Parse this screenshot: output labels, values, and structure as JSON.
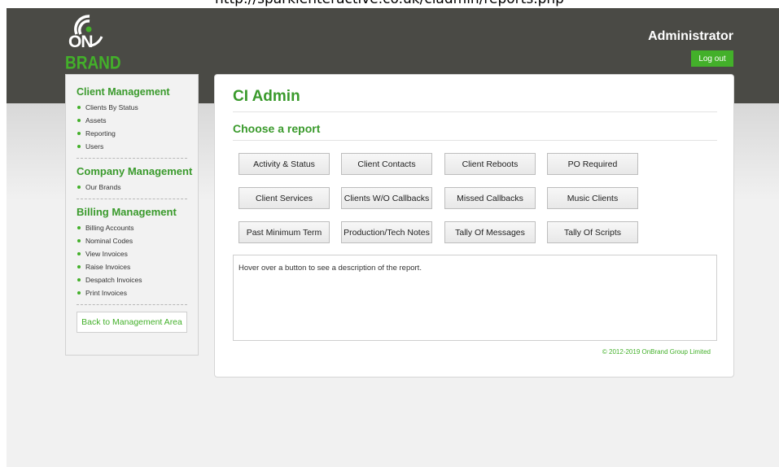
{
  "browser": {
    "url": "http://sparklenteractive.co.uk/ciadmin/reports.php"
  },
  "header": {
    "logo_top": "ON",
    "logo_bottom": "BRAND",
    "user_title": "Administrator",
    "logout_label": "Log out"
  },
  "sidebar": {
    "client_heading": "Client Management",
    "client_items": [
      "Clients By Status",
      "Assets",
      "Reporting",
      "Users"
    ],
    "company_heading": "Company Management",
    "company_items": [
      "Our Brands"
    ],
    "billing_heading": "Billing Management",
    "billing_items": [
      "Billing Accounts",
      "Nominal Codes",
      "View Invoices",
      "Raise Invoices",
      "Despatch Invoices",
      "Print Invoices"
    ],
    "back_label": "Back to Management Area"
  },
  "main": {
    "title": "CI Admin",
    "subtitle": "Choose a report",
    "reports": [
      "Activity & Status",
      "Client Contacts",
      "Client Reboots",
      "PO Required",
      "Client Services",
      "Clients W/O Callbacks",
      "Missed Callbacks",
      "Music Clients",
      "Past Minimum Term",
      "Production/Tech Notes",
      "Tally Of Messages",
      "Tally Of Scripts"
    ],
    "description": "Hover over a button to see a description of the report.",
    "copyright": "© 2012-2019 OnBrand Group Limited"
  },
  "colors": {
    "accent": "#43b02a",
    "header": "#4a4a45"
  }
}
